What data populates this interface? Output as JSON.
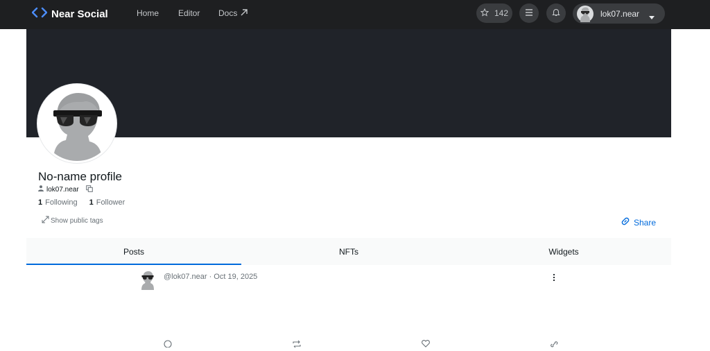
{
  "nav": {
    "brand": "Near Social",
    "links": [
      {
        "label": "Home"
      },
      {
        "label": "Editor"
      },
      {
        "label": "Docs"
      }
    ],
    "stars": "142",
    "account": "lok07.near"
  },
  "profile": {
    "name": "No-name profile",
    "handle": "lok07.near",
    "following_count": "1",
    "following_label": "Following",
    "follower_count": "1",
    "follower_label": "Follower",
    "tags_toggle": "Show public tags",
    "share": "Share"
  },
  "tabs": [
    {
      "label": "Posts",
      "active": true
    },
    {
      "label": "NFTs",
      "active": false
    },
    {
      "label": "Widgets",
      "active": false
    }
  ],
  "post": {
    "meta": "@lok07.near · Oct 19, 2025"
  },
  "colors": {
    "nav_bg": "#1e1f21",
    "banner_bg": "#202329",
    "accent": "#006adc",
    "brand_icon": "#4c8dff"
  }
}
